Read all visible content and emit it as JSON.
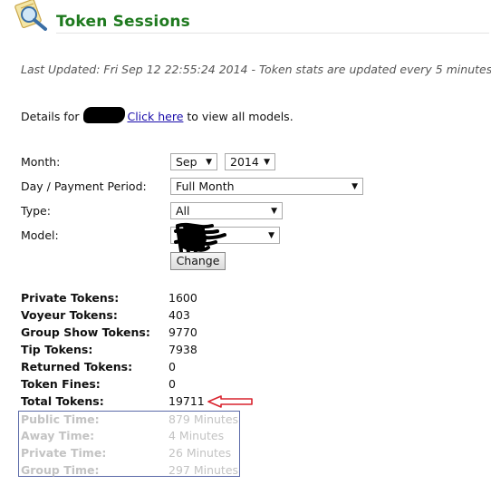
{
  "header": {
    "title": "Token Sessions",
    "icon": "magnifier-on-document-icon"
  },
  "last_updated": "Last Updated: Fri Sep 12 22:55:24 2014 - Token stats are updated every 5 minutes",
  "details": {
    "prefix": "Details for",
    "link_text": "Click here",
    "suffix": "to view all models."
  },
  "form": {
    "month_label": "Month:",
    "month_value": "Sep",
    "year_value": "2014",
    "day_label": "Day / Payment Period:",
    "day_value": "Full Month",
    "type_label": "Type:",
    "type_value": "All",
    "model_label": "Model:",
    "model_value": "",
    "change_button": "Change"
  },
  "stats": [
    {
      "label": "Private Tokens:",
      "value": "1600"
    },
    {
      "label": "Voyeur Tokens:",
      "value": "403"
    },
    {
      "label": "Group Show Tokens:",
      "value": "9770"
    },
    {
      "label": "Tip Tokens:",
      "value": "7938"
    },
    {
      "label": "Returned Tokens:",
      "value": "0"
    },
    {
      "label": "Token Fines:",
      "value": "0"
    },
    {
      "label": "Total Tokens:",
      "value": "19711"
    }
  ],
  "times": [
    {
      "label": "Public Time:",
      "value": "879 Minutes"
    },
    {
      "label": "Away Time:",
      "value": "4 Minutes"
    },
    {
      "label": "Private Time:",
      "value": "26 Minutes"
    },
    {
      "label": "Group Time:",
      "value": "297 Minutes"
    }
  ],
  "colors": {
    "title": "#1f7a1f",
    "link": "#1a0dab",
    "annotation_arrow": "#d9232e",
    "box_border": "#5b6aa8",
    "muted_text": "#c3c3c3"
  }
}
